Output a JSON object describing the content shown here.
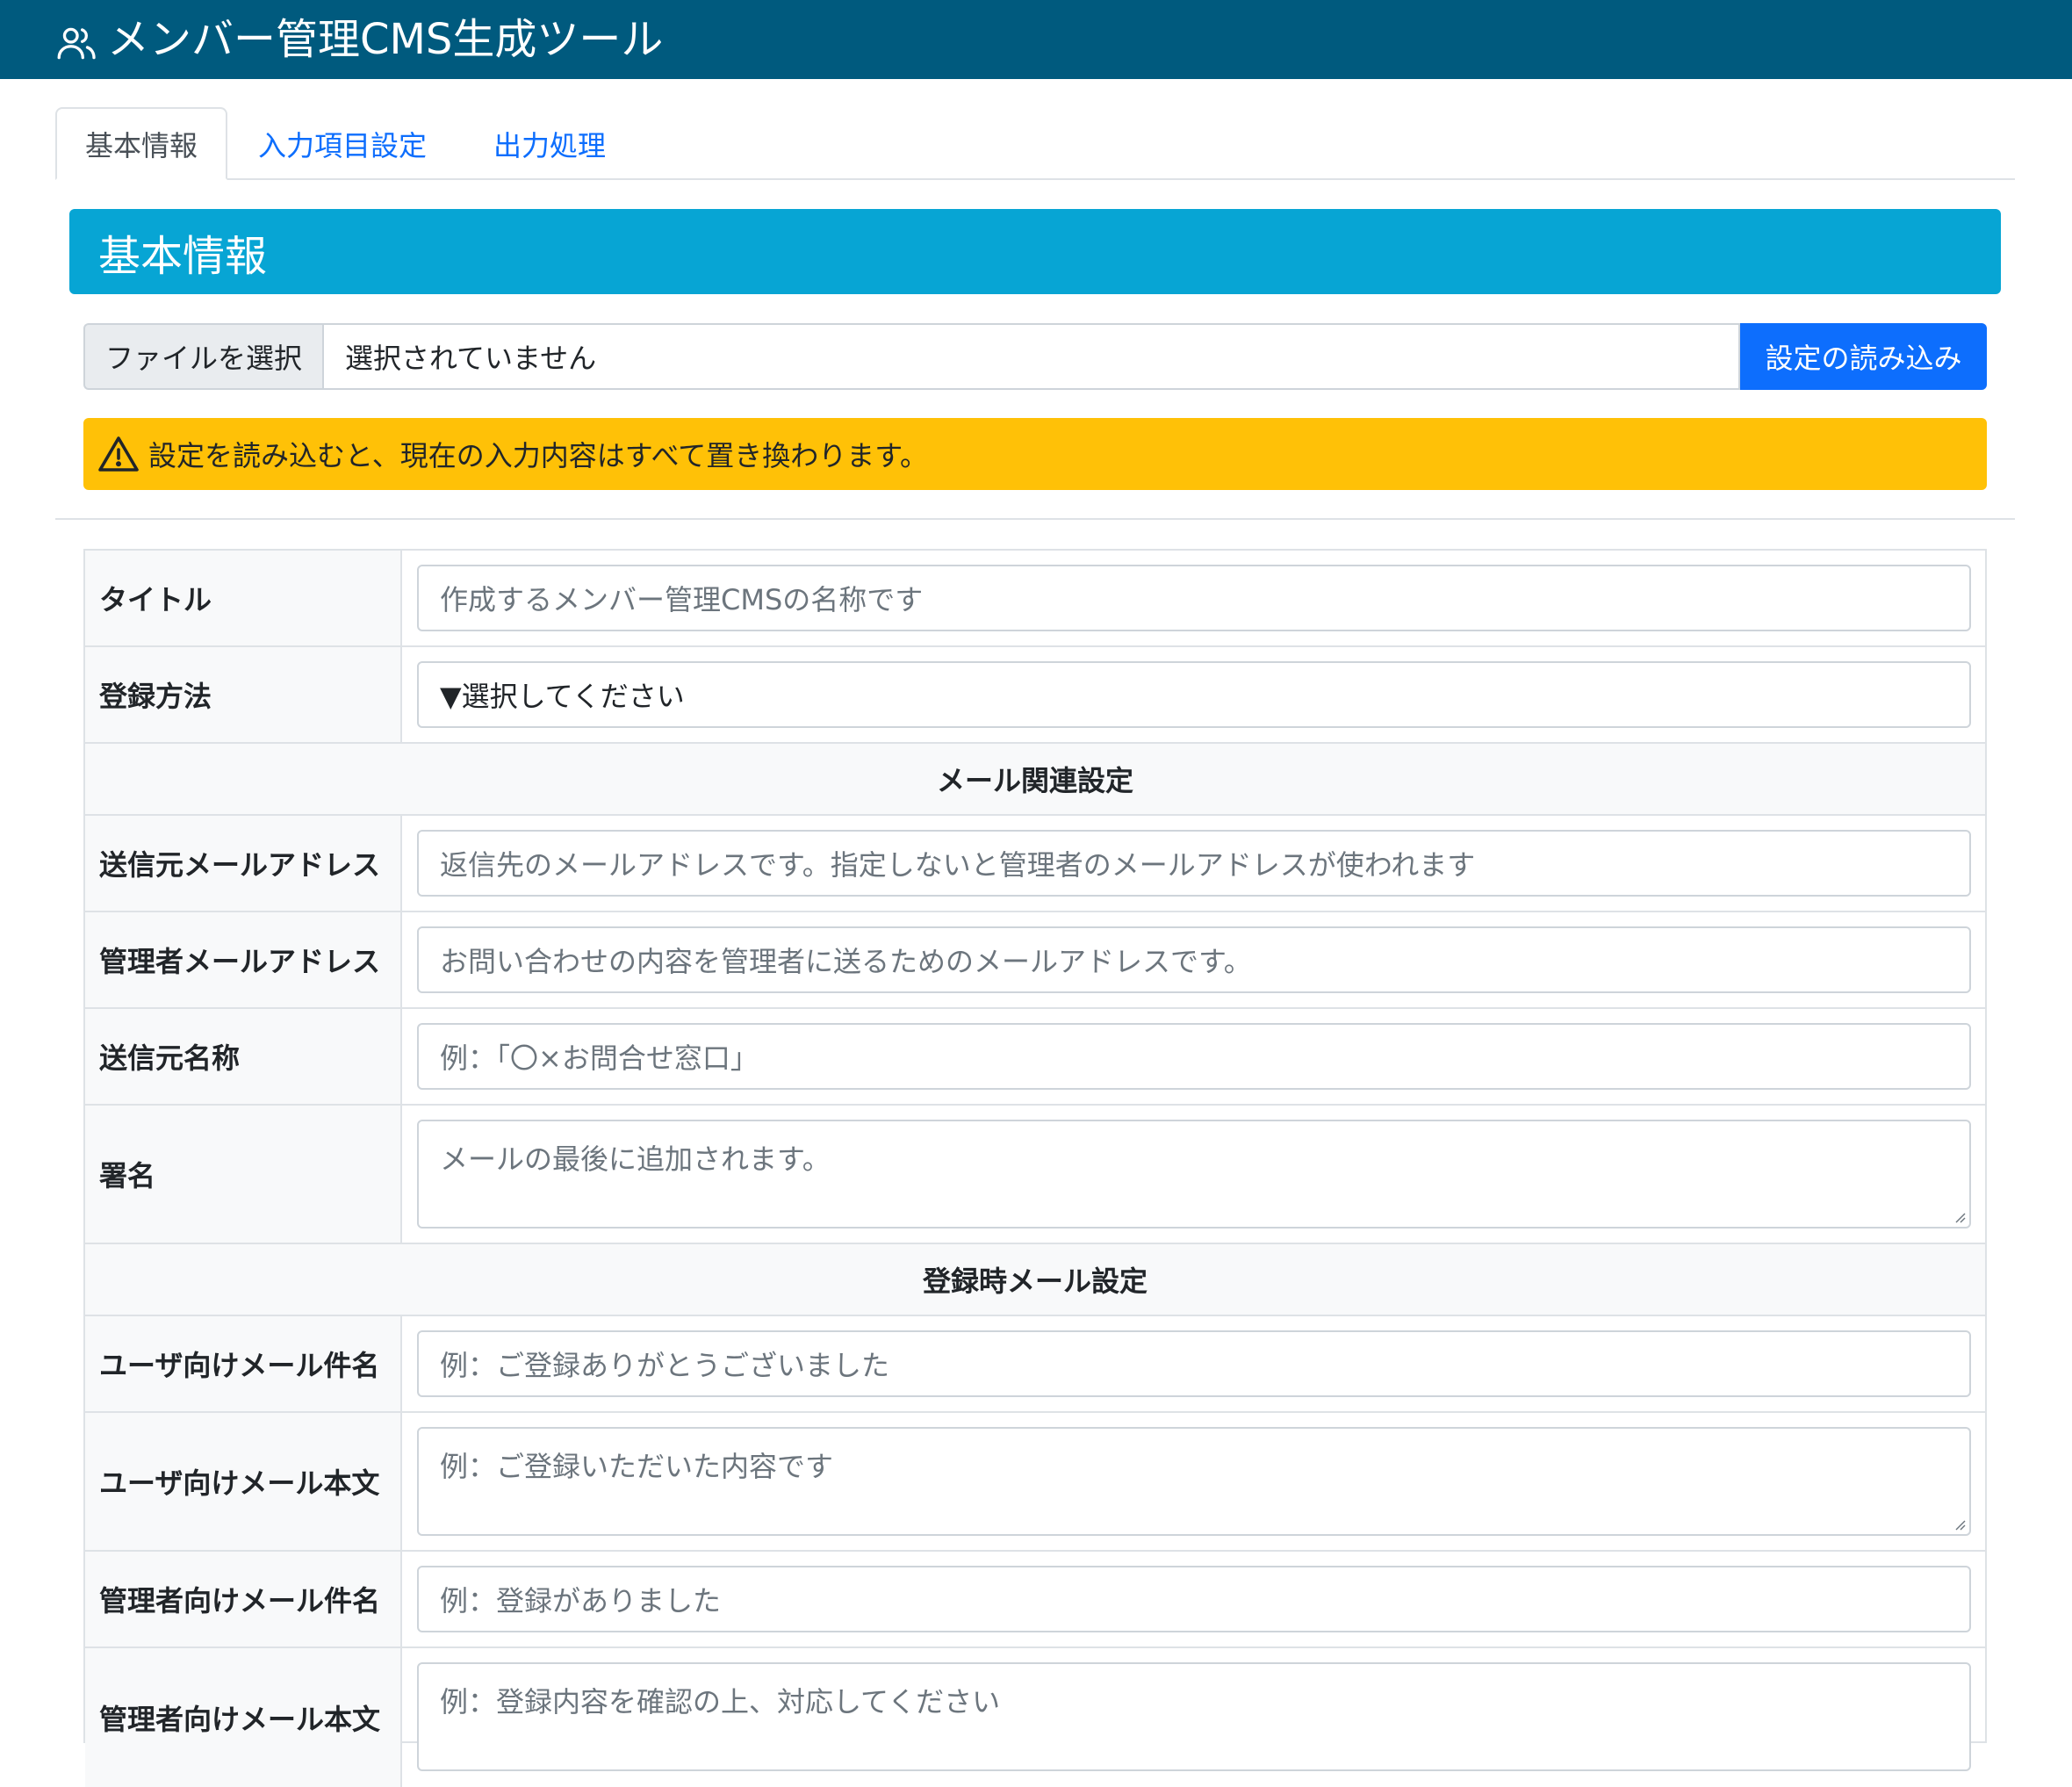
{
  "app": {
    "title": "メンバー管理CMS生成ツール"
  },
  "tabs": [
    {
      "label": "基本情報",
      "active": true
    },
    {
      "label": "入力項目設定",
      "active": false
    },
    {
      "label": "出力処理",
      "active": false
    }
  ],
  "section": {
    "title": "基本情報"
  },
  "file_input": {
    "button_label": "ファイルを選択",
    "status": "選択されていません",
    "load_button": "設定の読み込み"
  },
  "alert": {
    "message": "設定を読み込むと、現在の入力内容はすべて置き換わります。"
  },
  "form": {
    "title": {
      "label": "タイトル",
      "placeholder": "作成するメンバー管理CMSの名称です"
    },
    "registration": {
      "label": "登録方法",
      "selected": "▼選択してください"
    },
    "mail_settings_header": "メール関連設定",
    "from_address": {
      "label": "送信元メールアドレス",
      "placeholder": "返信先のメールアドレスです。指定しないと管理者のメールアドレスが使われます"
    },
    "admin_address": {
      "label": "管理者メールアドレス",
      "placeholder": "お問い合わせの内容を管理者に送るためのメールアドレスです。"
    },
    "from_name": {
      "label": "送信元名称",
      "placeholder": "例：「〇×お問合せ窓口」"
    },
    "signature": {
      "label": "署名",
      "placeholder": "メールの最後に追加されます。"
    },
    "registration_mail_header": "登録時メール設定",
    "user_subject": {
      "label": "ユーザ向けメール件名",
      "placeholder": "例：ご登録ありがとうございました"
    },
    "user_body": {
      "label": "ユーザ向けメール本文",
      "placeholder": "例：ご登録いただいた内容です"
    },
    "admin_subject": {
      "label": "管理者向けメール件名",
      "placeholder": "例：登録がありました"
    },
    "admin_body": {
      "label": "管理者向けメール本文",
      "placeholder": "例：登録内容を確認の上、対応してください"
    }
  },
  "colors": {
    "navbar": "#005a7e",
    "section_header": "#07a5d4",
    "primary": "#0d6efd",
    "warning": "#ffc107"
  }
}
